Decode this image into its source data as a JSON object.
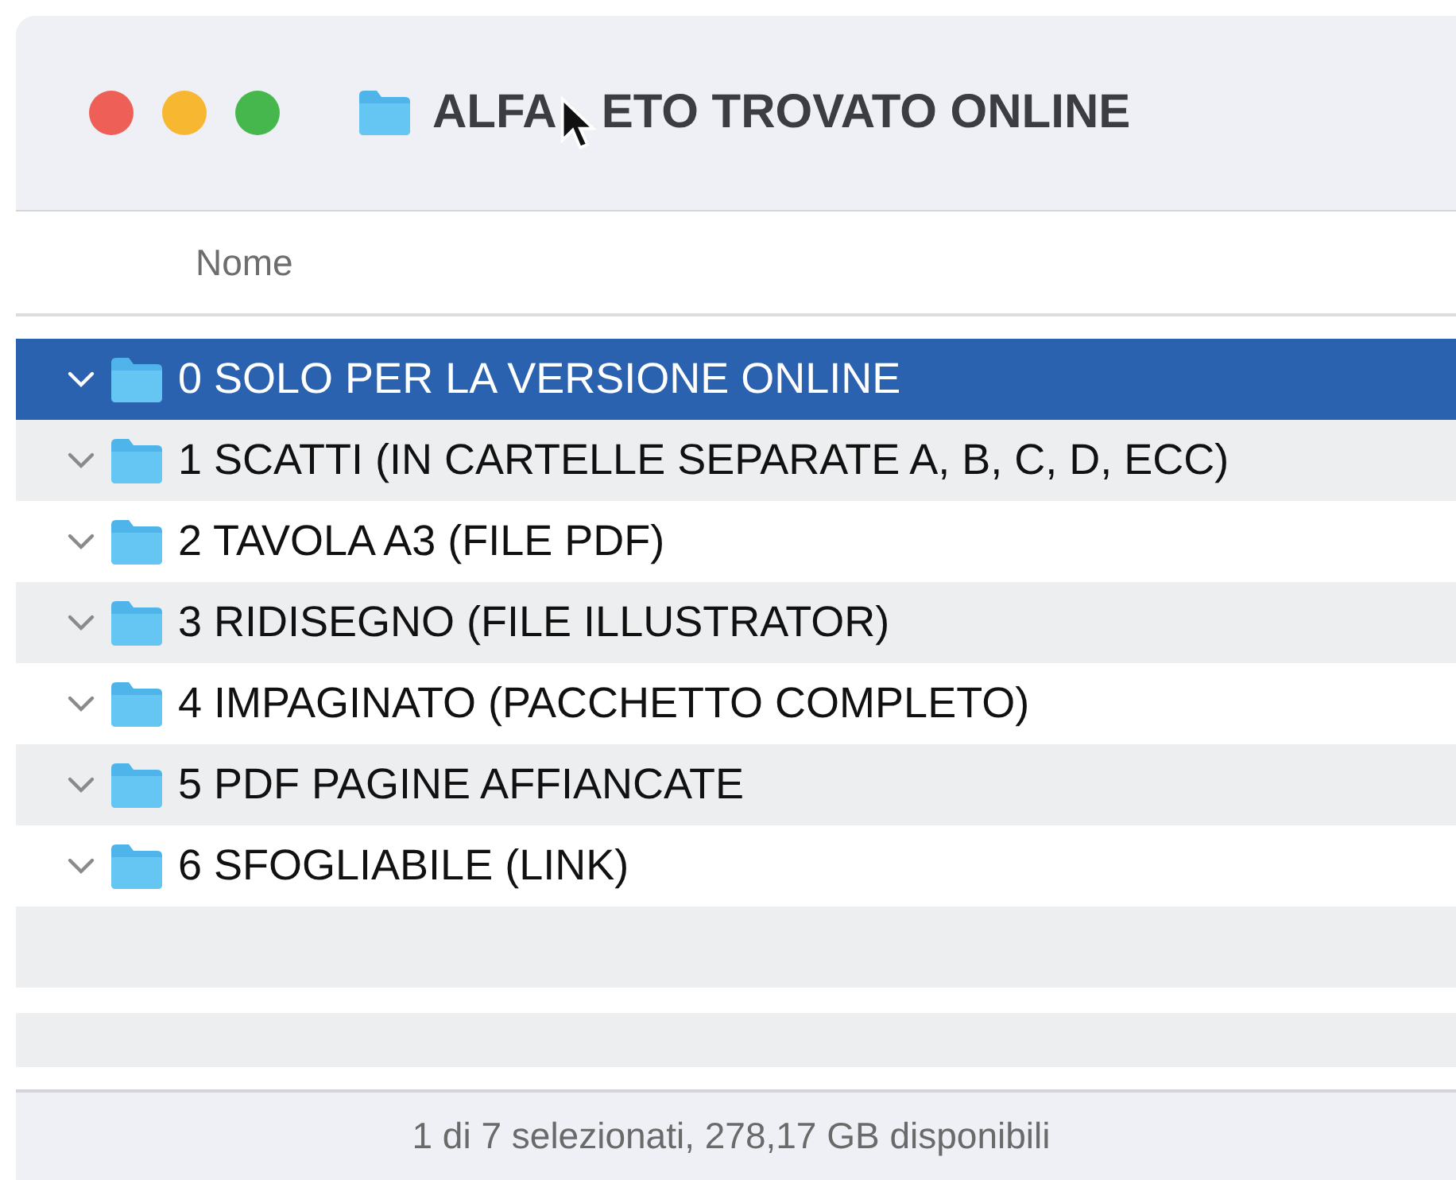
{
  "window": {
    "title_parts": [
      "ALFA",
      "ETO TROVATO ONLINE"
    ]
  },
  "columns": [
    {
      "label": "Nome"
    }
  ],
  "rows": [
    {
      "name": "0 SOLO PER LA VERSIONE ONLINE",
      "selected": true,
      "expanded": true
    },
    {
      "name": "1 SCATTI (IN CARTELLE SEPARATE A, B, C, D, ECC)",
      "selected": false,
      "expanded": true
    },
    {
      "name": "2 TAVOLA A3 (FILE PDF)",
      "selected": false,
      "expanded": true
    },
    {
      "name": "3 RIDISEGNO (FILE ILLUSTRATOR)",
      "selected": false,
      "expanded": true
    },
    {
      "name": "4 IMPAGINATO (PACCHETTO COMPLETO)",
      "selected": false,
      "expanded": true
    },
    {
      "name": "5 PDF PAGINE AFFIANCATE",
      "selected": false,
      "expanded": true
    },
    {
      "name": "6 SFOGLIABILE (LINK)",
      "selected": false,
      "expanded": true
    }
  ],
  "status_bar": "1 di 7 selezionati, 278,17 GB disponibili"
}
